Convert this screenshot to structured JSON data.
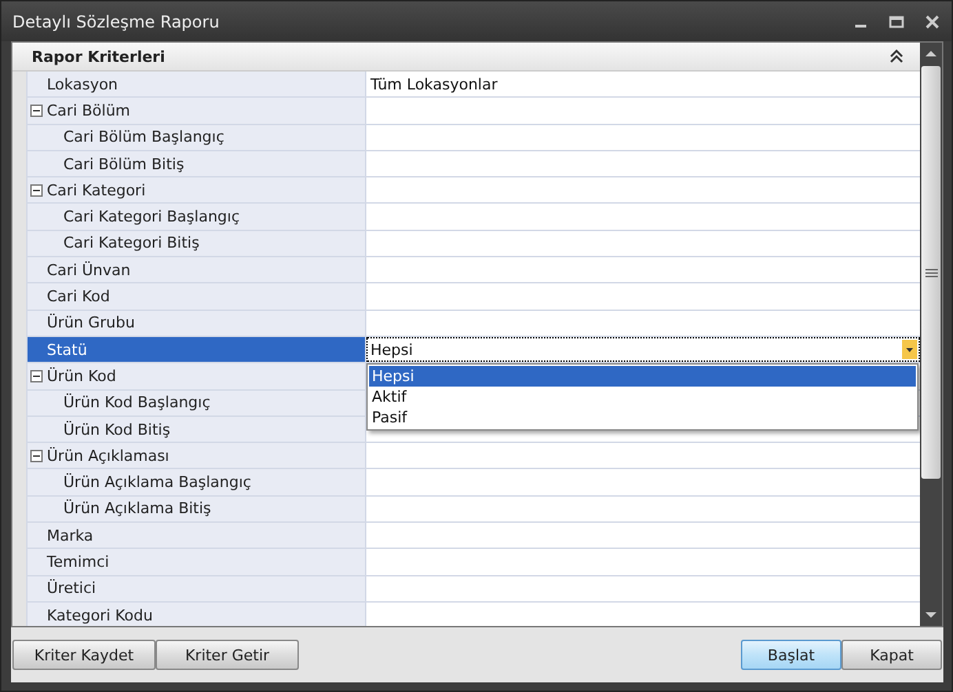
{
  "window": {
    "title": "Detaylı Sözleşme Raporu"
  },
  "panel": {
    "title": "Rapor Kriterleri",
    "expanded": true
  },
  "rows": [
    {
      "label": "Lokasyon",
      "value": "Tüm Lokasyonlar",
      "selected": false
    },
    {
      "label": "Cari Bölüm",
      "expanded": true,
      "children": [
        {
          "label": "Cari Bölüm Başlangıç",
          "selected": false
        },
        {
          "label": "Cari Bölüm Bitiş",
          "selected": false
        }
      ]
    },
    {
      "label": "Cari Kategori",
      "expanded": true,
      "children": [
        {
          "label": "Cari Kategori Başlangıç",
          "selected": false
        },
        {
          "label": "Cari Kategori Bitiş",
          "selected": false
        }
      ]
    },
    {
      "label": "Cari Ünvan",
      "selected": false
    },
    {
      "label": "Cari Kod",
      "selected": false
    },
    {
      "label": "Ürün Grubu",
      "selected": false
    },
    {
      "label": "Statü",
      "value": "Hepsi",
      "selected": true,
      "dropdown": {
        "open": true,
        "options": [
          {
            "label": "Hepsi",
            "selected": true
          },
          {
            "label": "Aktif",
            "selected": false
          },
          {
            "label": "Pasif",
            "selected": false
          }
        ]
      }
    },
    {
      "label": "Ürün Kod",
      "expanded": true,
      "children": [
        {
          "label": "Ürün Kod Başlangıç",
          "selected": false
        },
        {
          "label": "Ürün Kod Bitiş",
          "selected": false
        }
      ]
    },
    {
      "label": "Ürün Açıklaması",
      "expanded": true,
      "children": [
        {
          "label": "Ürün Açıklama Başlangıç",
          "selected": false
        },
        {
          "label": "Ürün Açıklama Bitiş",
          "selected": false
        }
      ]
    },
    {
      "label": "Marka",
      "selected": false
    },
    {
      "label": "Temimci",
      "selected": false
    },
    {
      "label": "Üretici",
      "selected": false
    },
    {
      "label": "Kategori Kodu",
      "selected": false
    }
  ],
  "buttons_left": [
    {
      "label": "Kriter Kaydet",
      "default": false
    },
    {
      "label": "Kriter Getir",
      "default": false
    }
  ],
  "buttons_right": [
    {
      "label": "Başlat",
      "default": true
    },
    {
      "label": "Kapat",
      "default": false
    }
  ]
}
